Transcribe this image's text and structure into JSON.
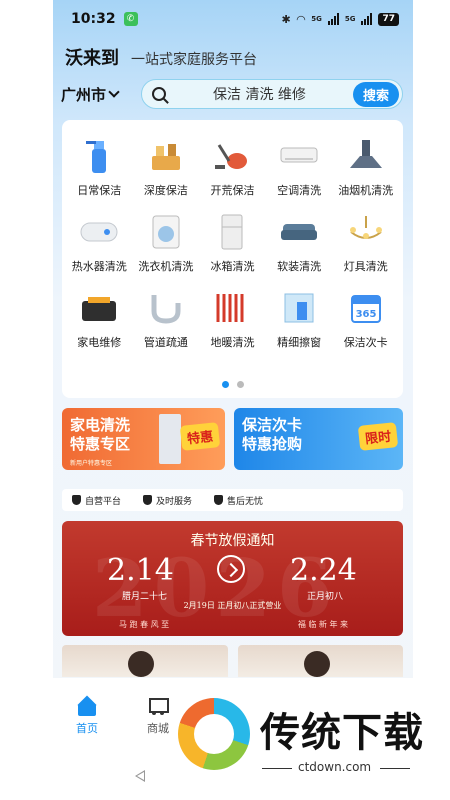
{
  "status": {
    "time": "10:32",
    "battery": "77",
    "net1": "5G",
    "net2": "5G"
  },
  "header": {
    "brand": "沃来到",
    "slogan": "一站式家庭服务平台"
  },
  "location": {
    "city": "广州市"
  },
  "search": {
    "placeholder": "保洁 清洗 维修",
    "button": "搜索"
  },
  "services": [
    {
      "label": "日常保洁",
      "icon": "spray-bottle-icon"
    },
    {
      "label": "深度保洁",
      "icon": "cleaning-bucket-icon"
    },
    {
      "label": "开荒保洁",
      "icon": "vacuum-cleaner-icon"
    },
    {
      "label": "空调清洗",
      "icon": "air-conditioner-icon"
    },
    {
      "label": "油烟机清洗",
      "icon": "range-hood-icon"
    },
    {
      "label": "热水器清洗",
      "icon": "water-heater-icon"
    },
    {
      "label": "洗衣机清洗",
      "icon": "washing-machine-icon"
    },
    {
      "label": "冰箱清洗",
      "icon": "refrigerator-icon"
    },
    {
      "label": "软装清洗",
      "icon": "sofa-icon"
    },
    {
      "label": "灯具清洗",
      "icon": "chandelier-icon"
    },
    {
      "label": "家电维修",
      "icon": "toolbox-icon"
    },
    {
      "label": "管道疏通",
      "icon": "pipe-icon"
    },
    {
      "label": "地暖清洗",
      "icon": "floor-heating-icon"
    },
    {
      "label": "精细擦窗",
      "icon": "window-cleaning-icon"
    },
    {
      "label": "保洁次卡",
      "icon": "calendar-365-icon"
    }
  ],
  "promos": [
    {
      "title1": "家电清洗",
      "title2": "特惠专区",
      "tag": "特惠",
      "sub": "新用户特惠专区"
    },
    {
      "title1": "保洁次卡",
      "title2": "特惠抢购",
      "tag": "限时"
    }
  ],
  "guarantees": [
    "自营平台",
    "及时服务",
    "售后无忧"
  ],
  "notice": {
    "title": "春节放假通知",
    "start": "2.14",
    "start_lunar": "腊月二十七",
    "end": "2.24",
    "end_lunar": "正月初八",
    "reopen": "2月19日 正月初八正式营业",
    "couplet_left": "马 跑 春 风 至",
    "couplet_right": "福 临 新 年 来",
    "bg_year": "2026"
  },
  "nav": {
    "home": "首页",
    "shop": "商城"
  },
  "watermark": {
    "brand": "传统下载",
    "url": "ctdown.com"
  }
}
